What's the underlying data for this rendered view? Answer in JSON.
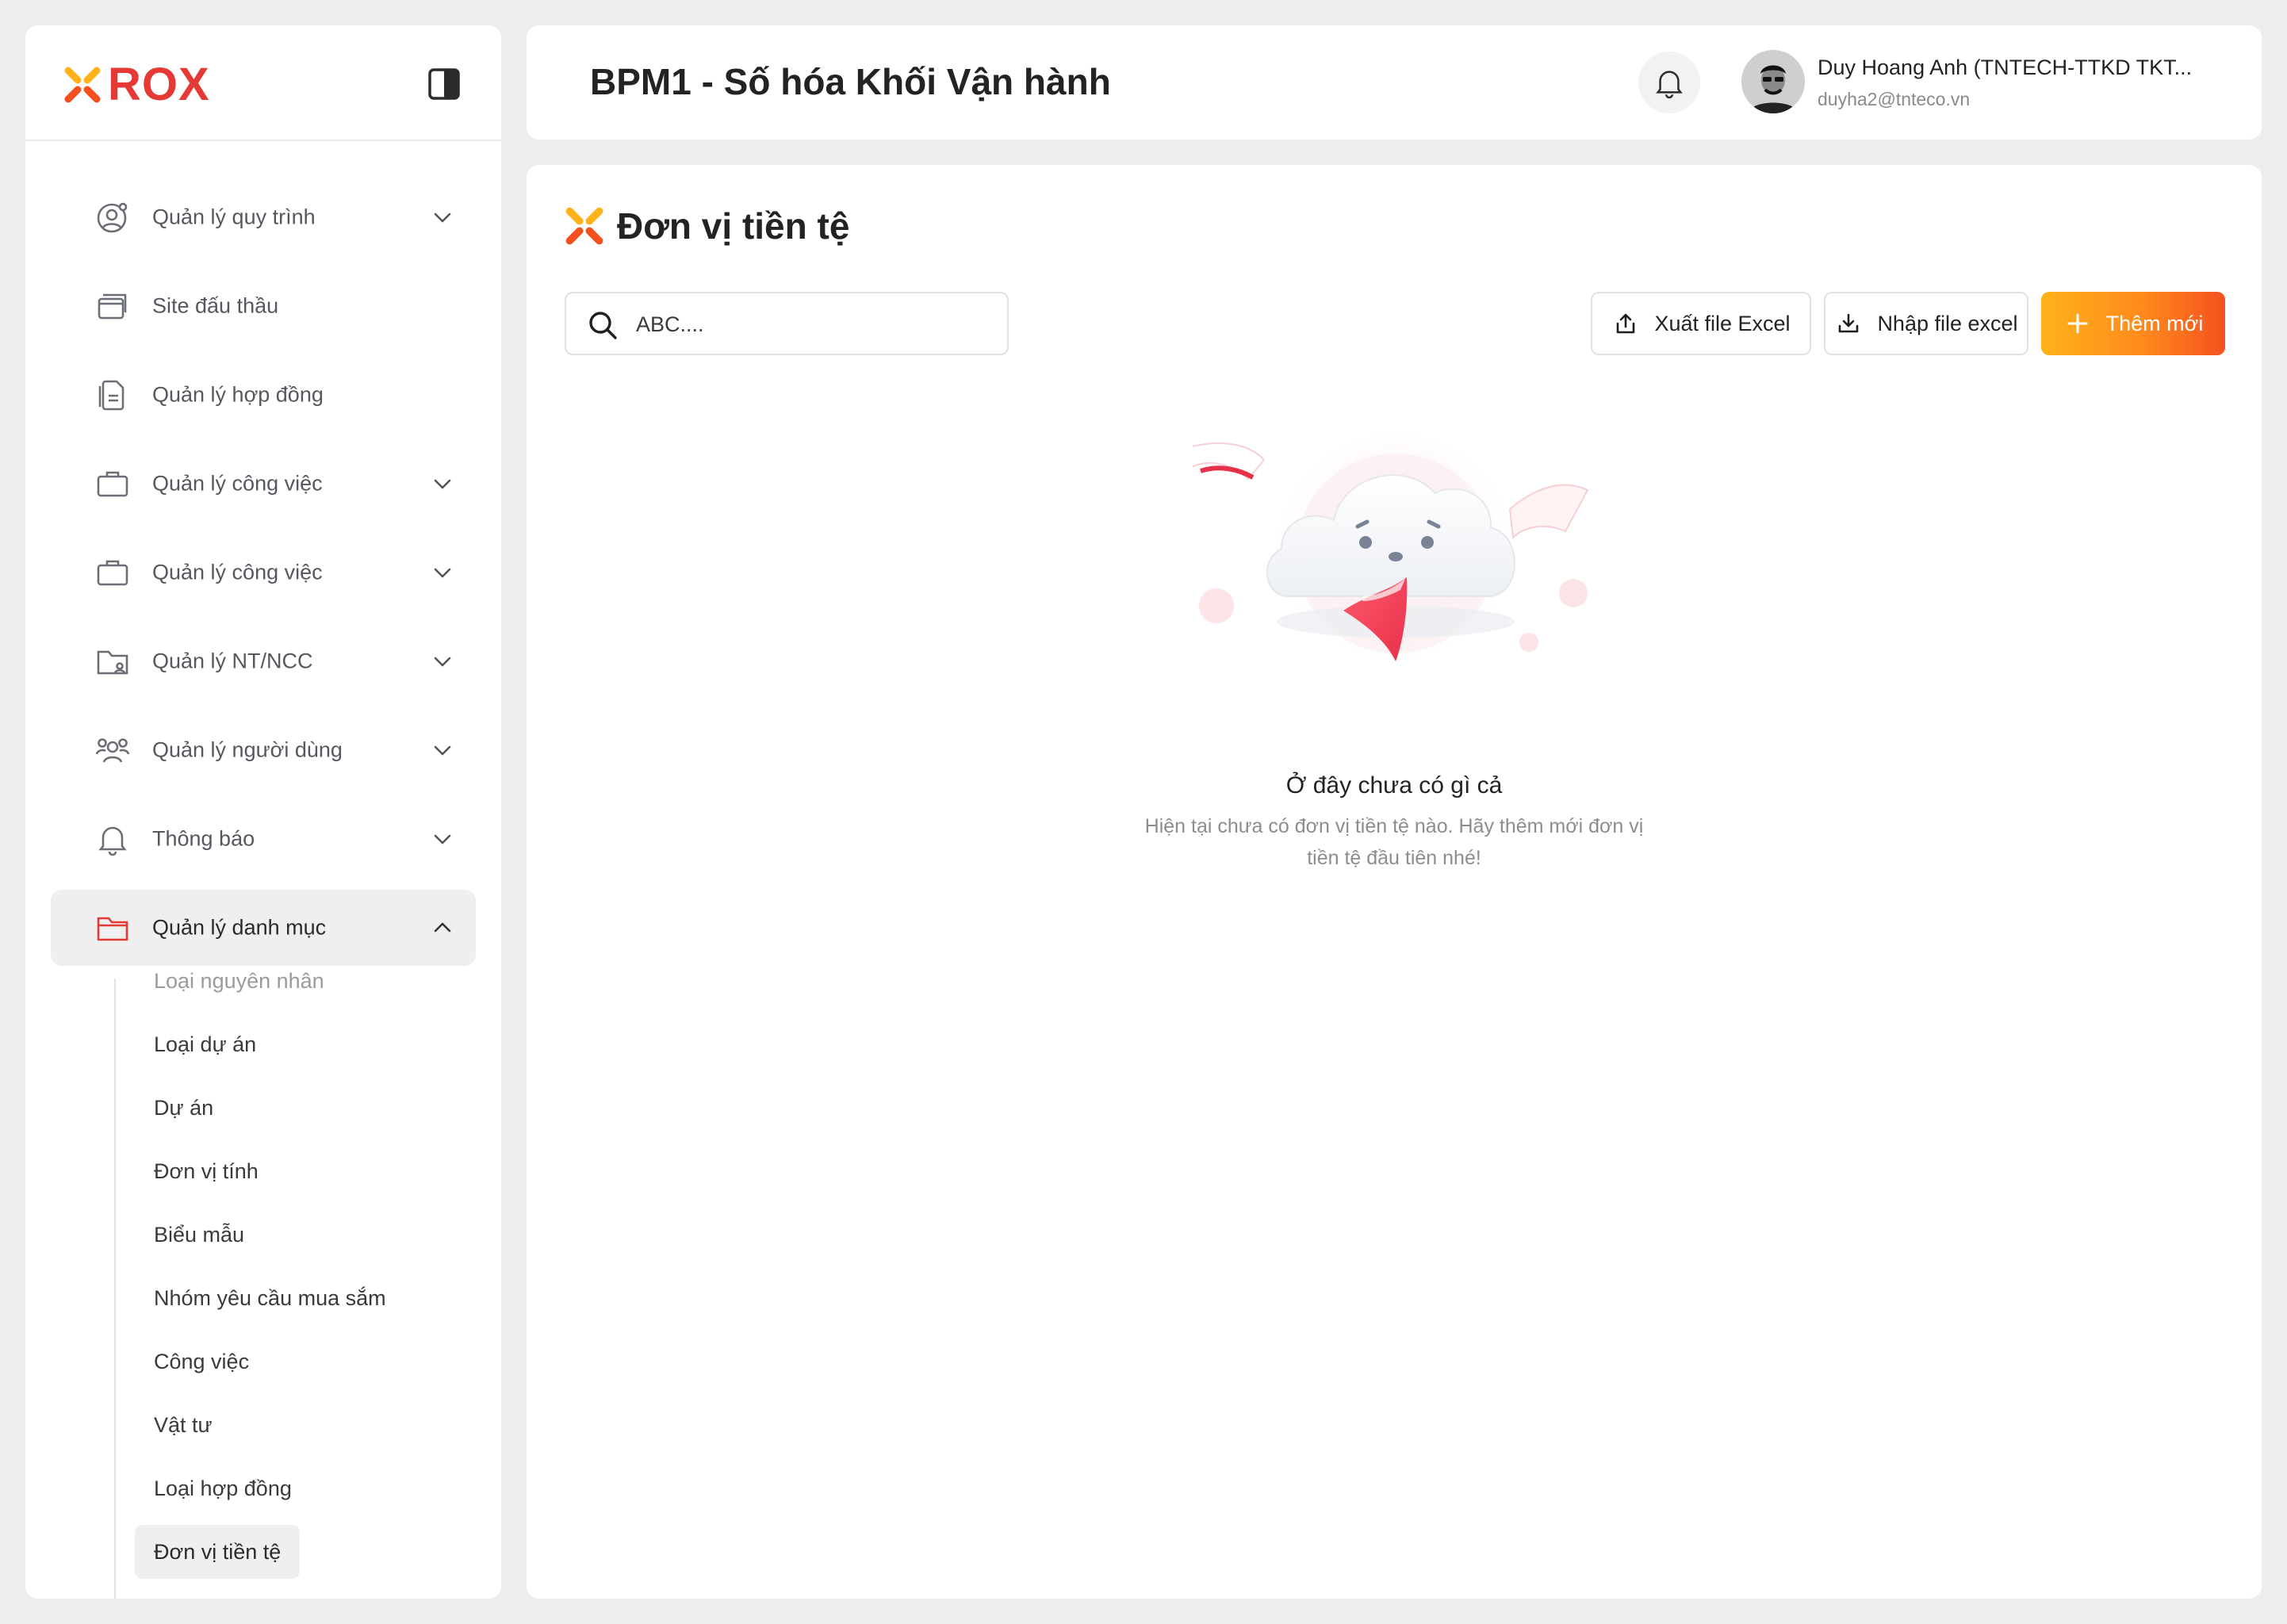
{
  "brand": {
    "logo_text": "ROX",
    "accent": "#f4511e",
    "logo_color": "#e53935"
  },
  "sidebar": {
    "items": [
      {
        "label": "Quản lý quy trình",
        "icon": "user-settings-icon",
        "expandable": true
      },
      {
        "label": "Site đấu thầu",
        "icon": "windows-icon",
        "expandable": false
      },
      {
        "label": "Quản lý hợp đồng",
        "icon": "documents-icon",
        "expandable": false
      },
      {
        "label": "Quản lý công việc",
        "icon": "briefcase-icon",
        "expandable": true
      },
      {
        "label": "Quản lý công việc",
        "icon": "briefcase-icon",
        "expandable": true
      },
      {
        "label": "Quản lý NT/NCC",
        "icon": "folder-user-icon",
        "expandable": true
      },
      {
        "label": "Quản lý người dùng",
        "icon": "users-icon",
        "expandable": true
      },
      {
        "label": "Thông báo",
        "icon": "bell-icon",
        "expandable": true
      },
      {
        "label": "Quản lý danh mục",
        "icon": "folder-icon",
        "expandable": true,
        "active": true
      }
    ],
    "submenu": [
      {
        "label": "Loại nguyên nhân"
      },
      {
        "label": "Loại dự án"
      },
      {
        "label": "Dự án"
      },
      {
        "label": "Đơn vị tính"
      },
      {
        "label": "Biểu mẫu"
      },
      {
        "label": "Nhóm yêu cầu mua sắm"
      },
      {
        "label": "Công việc"
      },
      {
        "label": "Vật tư"
      },
      {
        "label": "Loại hợp đồng"
      },
      {
        "label": "Đơn vị tiền tệ",
        "active": true
      }
    ]
  },
  "header": {
    "title": "BPM1 - Số hóa Khối Vận hành",
    "user": {
      "name": "Duy Hoang Anh (TNTECH-TTKD TKT...",
      "email": "duyha2@tnteco.vn"
    }
  },
  "main": {
    "page_title": "Đơn vị tiền tệ",
    "search": {
      "value": "",
      "placeholder": "ABC...."
    },
    "buttons": {
      "export": "Xuất file Excel",
      "import": "Nhập file excel",
      "add": "Thêm mới"
    },
    "empty_state": {
      "title": "Ở đây chưa có gì cả",
      "description": "Hiện tại chưa có đơn vị tiền tệ nào. Hãy thêm mới đơn vị tiền tệ đầu tiên nhé!"
    }
  }
}
